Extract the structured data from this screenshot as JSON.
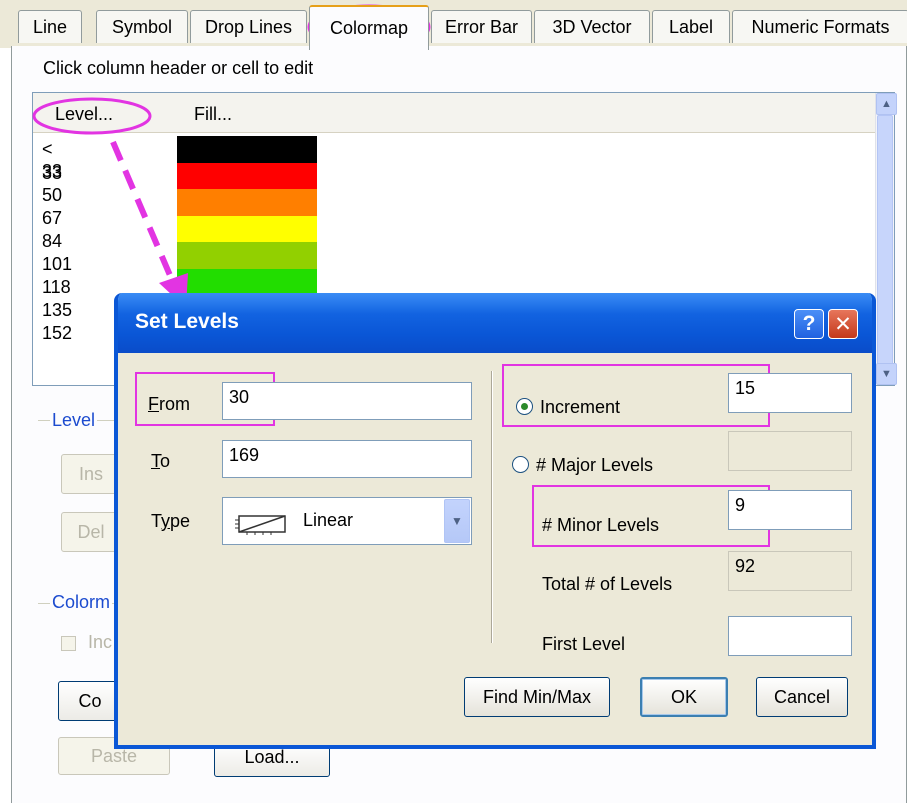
{
  "tabs": [
    "Line",
    "Symbol",
    "Drop Lines",
    "Colormap",
    "Error Bar",
    "3D Vector",
    "Label",
    "Numeric Formats"
  ],
  "hint": "Click column header or cell to edit",
  "grid": {
    "col_level": "Level...",
    "col_fill": "Fill...",
    "levels": [
      "< 33",
      "33",
      "50",
      "67",
      "84",
      "101",
      "118",
      "135",
      "152"
    ],
    "fill_colors": [
      "#000000",
      "#ff0000",
      "#ff7f00",
      "#ffff00",
      "#92d000",
      "#22dd00"
    ]
  },
  "background_groups": {
    "level_group": "Level",
    "insert_button": "Ins",
    "delete_button": "Del",
    "colormap_group": "Colorm",
    "include_check": "Inc",
    "copy_button": "Co",
    "paste_button": "Paste",
    "load_button": "Load..."
  },
  "dialog": {
    "title": "Set Levels",
    "help_glyph": "?",
    "close_glyph": "✕",
    "from_label": "From",
    "from_value": "30",
    "to_label": "To",
    "to_value": "169",
    "type_label": "Type",
    "type_value": "Linear",
    "increment_label": "Increment",
    "increment_value": "15",
    "major_label": "# Major Levels",
    "minor_label": "# Minor Levels",
    "minor_value": "9",
    "total_label": "Total # of Levels",
    "total_value": "92",
    "first_label": "First Level",
    "first_value": "",
    "findminmax_button": "Find Min/Max",
    "ok_button": "OK",
    "cancel_button": "Cancel"
  },
  "colors": {
    "highlight": "#e234e2",
    "title_bar": "#0a56d6"
  }
}
